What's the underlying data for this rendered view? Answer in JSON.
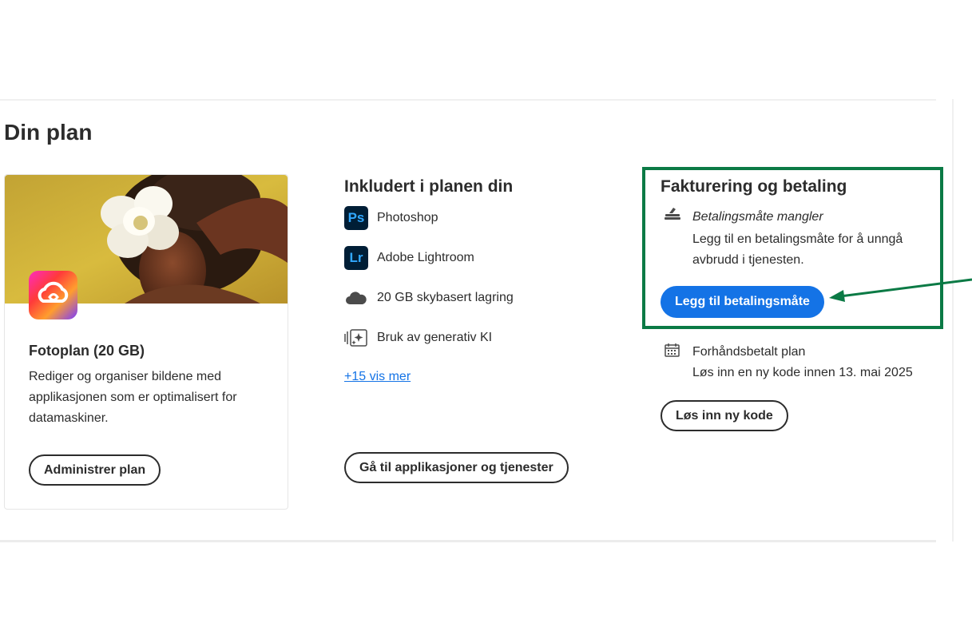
{
  "page_title": "Din plan",
  "plan": {
    "name": "Fotoplan (20 GB)",
    "description": "Rediger og organiser bildene med applikasjonen som er optimalisert for datamaskiner.",
    "manage_button": "Administrer plan"
  },
  "included": {
    "title": "Inkludert i planen din",
    "items": [
      {
        "label": "Photoshop",
        "icon": "photoshop-icon",
        "abbr": "Ps",
        "color": "#31a8ff"
      },
      {
        "label": "Adobe Lightroom",
        "icon": "lightroom-icon",
        "abbr": "Lr",
        "color": "#31a8ff"
      },
      {
        "label": "20 GB skybasert lagring",
        "icon": "cloud-icon"
      },
      {
        "label": "Bruk av generativ KI",
        "icon": "generative-ai-icon"
      }
    ],
    "more_link": "+15 vis mer",
    "apps_button": "Gå til applikasjoner og tjenester"
  },
  "billing": {
    "title": "Fakturering og betaling",
    "missing_title": "Betalingsmåte mangler",
    "missing_desc": "Legg til en betalingsmåte for å unngå avbrudd i tjenesten.",
    "add_payment_button": "Legg til betalingsmåte",
    "prepaid_title": "Forhåndsbetalt plan",
    "prepaid_desc": "Løs inn en ny kode innen 13. mai 2025",
    "redeem_button": "Løs inn ny kode"
  },
  "colors": {
    "accent": "#1473e6",
    "highlight_border": "#0b7a45",
    "app_icon_bg": "#001e36"
  }
}
